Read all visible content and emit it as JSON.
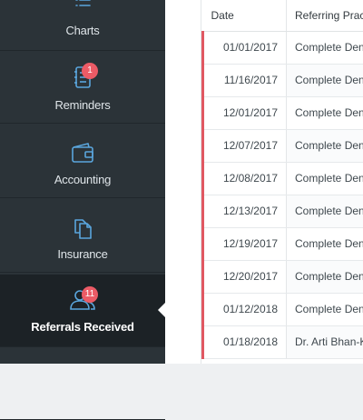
{
  "sidebar": {
    "items": [
      {
        "label": "Charts",
        "icon": "list-icon"
      },
      {
        "label": "Reminders",
        "icon": "notebook-icon",
        "badge": "1"
      },
      {
        "label": "Accounting",
        "icon": "wallet-icon"
      },
      {
        "label": "Insurance",
        "icon": "documents-icon"
      },
      {
        "label": "Referrals Received",
        "icon": "users-icon",
        "badge": "11",
        "active": true
      }
    ]
  },
  "colors": {
    "sidebar_bg": "#2b3338",
    "active_bg": "#1c2226",
    "icon_blue": "#5aa6dd",
    "badge_red": "#ec5b66",
    "row_marker_red": "#e05862"
  },
  "table": {
    "columns": [
      "Date",
      "Referring Practice"
    ],
    "rows": [
      {
        "date": "01/01/2017",
        "practice": "Complete Dentistry"
      },
      {
        "date": "11/16/2017",
        "practice": "Complete Dentistry"
      },
      {
        "date": "12/01/2017",
        "practice": "Complete Dentistry"
      },
      {
        "date": "12/07/2017",
        "practice": "Complete Dentistry"
      },
      {
        "date": "12/08/2017",
        "practice": "Complete Dentistry"
      },
      {
        "date": "12/13/2017",
        "practice": "Complete Dentistry"
      },
      {
        "date": "12/19/2017",
        "practice": "Complete Dentistry"
      },
      {
        "date": "12/20/2017",
        "practice": "Complete Dentistry"
      },
      {
        "date": "01/12/2018",
        "practice": "Complete Dentistry"
      },
      {
        "date": "01/18/2018",
        "practice": "Dr. Arti Bhan-Kachroo"
      }
    ]
  }
}
